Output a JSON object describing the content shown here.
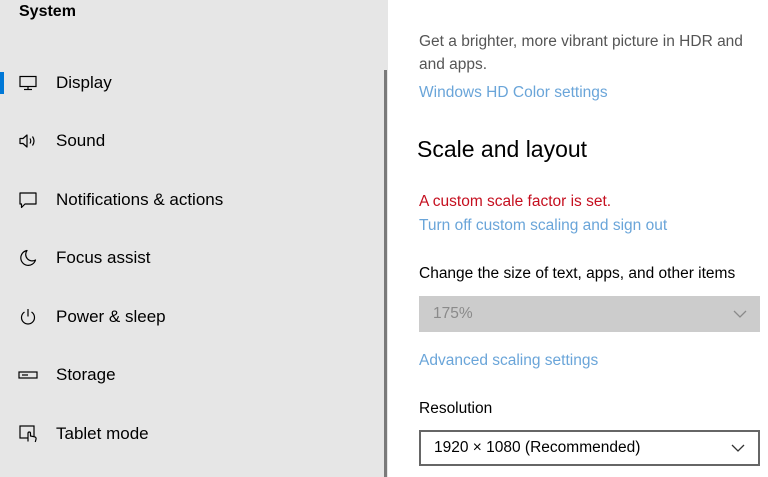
{
  "sidebar": {
    "title": "System",
    "items": [
      {
        "label": "Display",
        "icon": "monitor-icon",
        "selected": true
      },
      {
        "label": "Sound",
        "icon": "speaker-icon",
        "selected": false
      },
      {
        "label": "Notifications & actions",
        "icon": "notifications-icon",
        "selected": false
      },
      {
        "label": "Focus assist",
        "icon": "moon-icon",
        "selected": false
      },
      {
        "label": "Power & sleep",
        "icon": "power-icon",
        "selected": false
      },
      {
        "label": "Storage",
        "icon": "storage-icon",
        "selected": false
      },
      {
        "label": "Tablet mode",
        "icon": "tablet-mode-icon",
        "selected": false
      }
    ]
  },
  "main": {
    "hdr_description_line1": "Get a brighter, more vibrant picture in HDR and",
    "hdr_description_line2": "and apps.",
    "hdr_link": "Windows HD Color settings",
    "section_title": "Scale and layout",
    "scale_warning": "A custom scale factor is set.",
    "scale_link": "Turn off custom scaling and sign out",
    "scale_label": "Change the size of text, apps, and other items",
    "scale_value": "175%",
    "advanced_link": "Advanced scaling settings",
    "resolution_label": "Resolution",
    "resolution_value": "1920 × 1080 (Recommended)"
  },
  "colors": {
    "accent": "#0078d7",
    "link": "#6aa5d9",
    "warning": "#c50f1f",
    "sidebar_bg": "#e6e6e6",
    "disabled_bg": "#cccccc"
  }
}
